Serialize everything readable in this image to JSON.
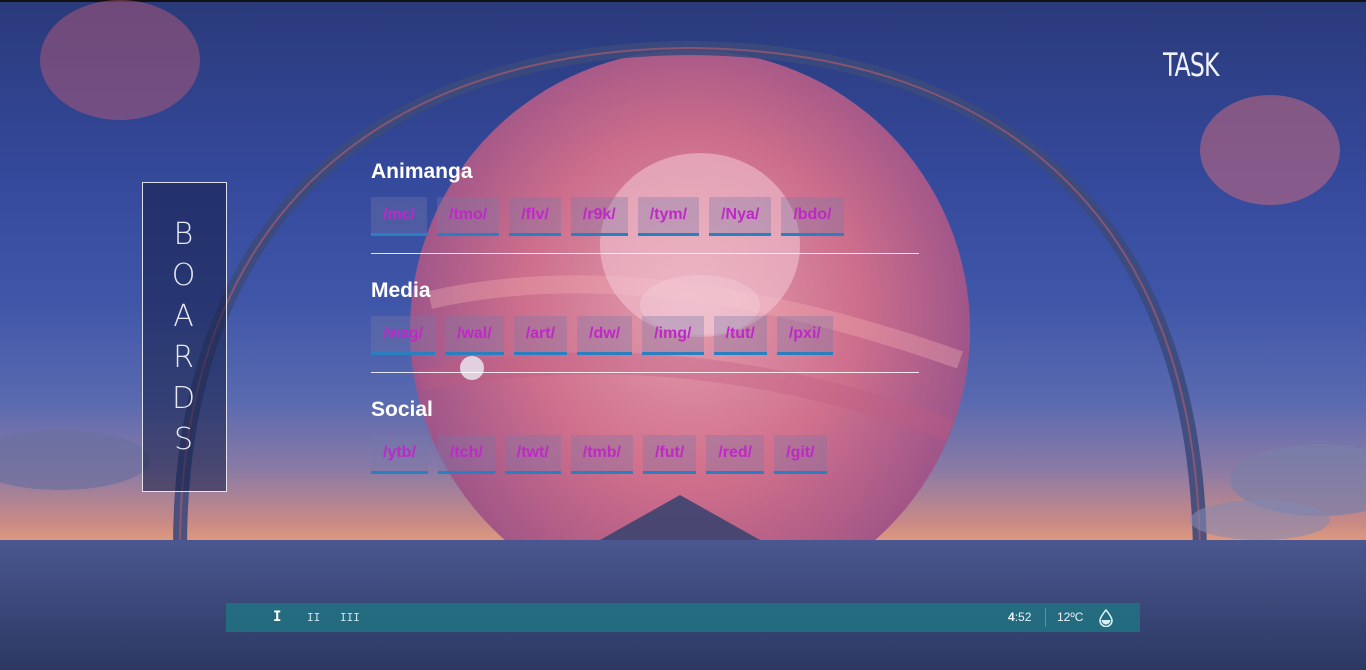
{
  "boards_label": [
    "B",
    "O",
    "A",
    "R",
    "D",
    "S"
  ],
  "task_title": "TASK",
  "sections": [
    {
      "title": "Animanga",
      "links": [
        "/mc/",
        "/tmo/",
        "/flv/",
        "/r9k/",
        "/tym/",
        "/Nya/",
        "/bdo/"
      ]
    },
    {
      "title": "Media",
      "links": [
        "/wag/",
        "/wal/",
        "/art/",
        "/dw/",
        "/img/",
        "/tut/",
        "/pxi/"
      ]
    },
    {
      "title": "Social",
      "links": [
        "/ytb/",
        "/tch/",
        "/twt/",
        "/tmb/",
        "/fut/",
        "/red/",
        "/git/"
      ]
    }
  ],
  "statusbar": {
    "workspaces": [
      "I",
      "II",
      "III"
    ],
    "active_workspace": "I",
    "clock_hour": "4",
    "clock_minute": ":52",
    "temperature": "12ºC",
    "weather_icon": "water-drop-icon"
  },
  "colors": {
    "link_text": "#c027c8",
    "link_underline": "#2a7fc0",
    "statusbar_bg": "#207482"
  }
}
